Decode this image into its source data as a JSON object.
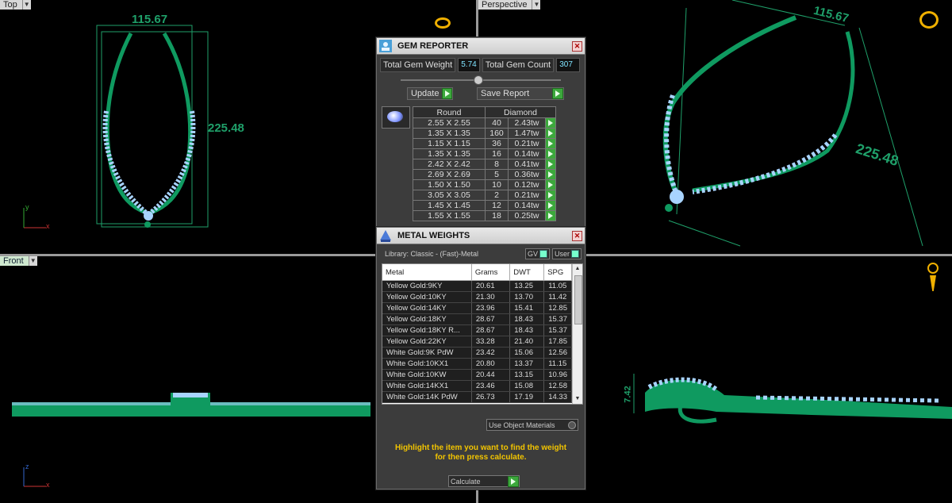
{
  "viewports": {
    "top": {
      "label": "Top",
      "dim_width": "115.67",
      "dim_height": "225.48"
    },
    "perspective": {
      "label": "Perspective",
      "dim_width": "115.67",
      "dim_height": "225.48"
    },
    "front": {
      "label": "Front"
    },
    "side": {
      "dim_height": "7.42"
    },
    "axes": {
      "x": "x",
      "y": "y",
      "z": "z"
    }
  },
  "gem_reporter": {
    "title": "GEM REPORTER",
    "total_weight_label": "Total Gem Weight",
    "total_weight_value": "5.74",
    "total_count_label": "Total Gem Count",
    "total_count_value": "307",
    "update_label": "Update",
    "save_report_label": "Save Report",
    "table_headers": [
      "Round",
      "Diamond"
    ],
    "rows": [
      {
        "size": "2.55 X 2.55",
        "count": "40",
        "weight": "2.43tw"
      },
      {
        "size": "1.35 X 1.35",
        "count": "160",
        "weight": "1.47tw"
      },
      {
        "size": "1.15 X 1.15",
        "count": "36",
        "weight": "0.21tw"
      },
      {
        "size": "1.35 X 1.35",
        "count": "16",
        "weight": "0.14tw"
      },
      {
        "size": "2.42 X 2.42",
        "count": "8",
        "weight": "0.41tw"
      },
      {
        "size": "2.69 X 2.69",
        "count": "5",
        "weight": "0.36tw"
      },
      {
        "size": "1.50 X 1.50",
        "count": "10",
        "weight": "0.12tw"
      },
      {
        "size": "3.05 X 3.05",
        "count": "2",
        "weight": "0.21tw"
      },
      {
        "size": "1.45 X 1.45",
        "count": "12",
        "weight": "0.14tw"
      },
      {
        "size": "1.55 X 1.55",
        "count": "18",
        "weight": "0.25tw"
      }
    ]
  },
  "metal_weights": {
    "title": "METAL WEIGHTS",
    "library_label": "Library: Classic - (Fast)-Metal",
    "gv_label": "GV",
    "user_label": "User",
    "headers": [
      "Metal",
      "Grams",
      "DWT",
      "SPG"
    ],
    "rows": [
      {
        "metal": "Yellow Gold:9KY",
        "grams": "20.61",
        "dwt": "13.25",
        "spg": "11.05"
      },
      {
        "metal": "Yellow Gold:10KY",
        "grams": "21.30",
        "dwt": "13.70",
        "spg": "11.42"
      },
      {
        "metal": "Yellow Gold:14KY",
        "grams": "23.96",
        "dwt": "15.41",
        "spg": "12.85"
      },
      {
        "metal": "Yellow Gold:18KY",
        "grams": "28.67",
        "dwt": "18.43",
        "spg": "15.37"
      },
      {
        "metal": "Yellow Gold:18KY R...",
        "grams": "28.67",
        "dwt": "18.43",
        "spg": "15.37"
      },
      {
        "metal": "Yellow Gold:22KY",
        "grams": "33.28",
        "dwt": "21.40",
        "spg": "17.85"
      },
      {
        "metal": "White Gold:9K PdW",
        "grams": "23.42",
        "dwt": "15.06",
        "spg": "12.56"
      },
      {
        "metal": "White Gold:10KX1",
        "grams": "20.80",
        "dwt": "13.37",
        "spg": "11.15"
      },
      {
        "metal": "White Gold:10KW",
        "grams": "20.44",
        "dwt": "13.15",
        "spg": "10.96"
      },
      {
        "metal": "White Gold:14KX1",
        "grams": "23.46",
        "dwt": "15.08",
        "spg": "12.58"
      },
      {
        "metal": "White Gold:14K PdW",
        "grams": "26.73",
        "dwt": "17.19",
        "spg": "14.33"
      }
    ],
    "use_object_materials": "Use Object Materials",
    "hint_line1": "Highlight the item you want to find the weight",
    "hint_line2": "for then press calculate.",
    "calculate_label": "Calculate"
  },
  "colors": {
    "metal_green": "#0f9a60",
    "gem_blue": "#a8d4ff",
    "dim_green": "#1fa06a",
    "hint_yellow": "#f2c400",
    "icon_gold": "#f0b000"
  }
}
